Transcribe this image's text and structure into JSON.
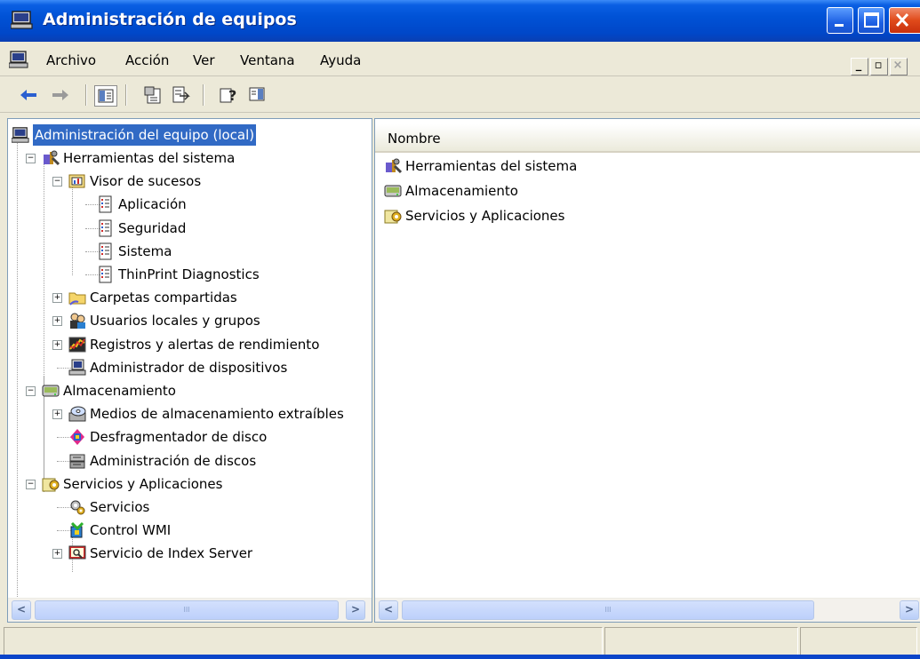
{
  "window": {
    "title": "Administración de equipos",
    "title_bar_color": "#0052d6",
    "buttons": [
      "minimize",
      "maximize",
      "close"
    ]
  },
  "menu": {
    "items": [
      "Archivo",
      "Acción",
      "Ver",
      "Ventana",
      "Ayuda"
    ],
    "mdi_controls": [
      "minimize",
      "restore",
      "close"
    ]
  },
  "toolbar": {
    "buttons": [
      "back-icon",
      "forward-icon",
      "show-hide-tree-icon",
      "properties-icon",
      "export-list-icon",
      "help-icon",
      "show-hide-action-pane-icon"
    ]
  },
  "tree": {
    "root": "Administración del equipo (local)",
    "items": [
      {
        "label": "Herramientas del sistema",
        "level": 1,
        "expander": "minus",
        "icon": "tools-icon"
      },
      {
        "label": "Visor de sucesos",
        "level": 2,
        "expander": "minus",
        "icon": "event-viewer-icon"
      },
      {
        "label": "Aplicación",
        "level": 3,
        "expander": "none",
        "icon": "log-icon"
      },
      {
        "label": "Seguridad",
        "level": 3,
        "expander": "none",
        "icon": "log-icon"
      },
      {
        "label": "Sistema",
        "level": 3,
        "expander": "none",
        "icon": "log-icon"
      },
      {
        "label": "ThinPrint Diagnostics",
        "level": 3,
        "expander": "none",
        "icon": "log-icon"
      },
      {
        "label": "Carpetas compartidas",
        "level": 2,
        "expander": "plus",
        "icon": "shared-folder-icon"
      },
      {
        "label": "Usuarios locales y grupos",
        "level": 2,
        "expander": "plus",
        "icon": "users-icon"
      },
      {
        "label": "Registros y alertas de rendimiento",
        "level": 2,
        "expander": "plus",
        "icon": "performance-icon"
      },
      {
        "label": "Administrador de dispositivos",
        "level": 2,
        "expander": "none",
        "icon": "device-manager-icon"
      },
      {
        "label": "Almacenamiento",
        "level": 1,
        "expander": "minus",
        "icon": "storage-icon"
      },
      {
        "label": "Medios de almacenamiento extraíbles",
        "level": 2,
        "expander": "plus",
        "icon": "removable-storage-icon"
      },
      {
        "label": "Desfragmentador de disco",
        "level": 2,
        "expander": "none",
        "icon": "defrag-icon"
      },
      {
        "label": "Administración de discos",
        "level": 2,
        "expander": "none",
        "icon": "disk-management-icon"
      },
      {
        "label": "Servicios y Aplicaciones",
        "level": 1,
        "expander": "minus",
        "icon": "services-apps-icon"
      },
      {
        "label": "Servicios",
        "level": 2,
        "expander": "none",
        "icon": "services-icon"
      },
      {
        "label": "Control WMI",
        "level": 2,
        "expander": "none",
        "icon": "wmi-icon"
      },
      {
        "label": "Servicio de Index Server",
        "level": 2,
        "expander": "plus",
        "icon": "index-server-icon"
      }
    ]
  },
  "list": {
    "column": "Nombre",
    "items": [
      {
        "label": "Herramientas del sistema",
        "icon": "tools-icon"
      },
      {
        "label": "Almacenamiento",
        "icon": "storage-icon"
      },
      {
        "label": "Servicios y Aplicaciones",
        "icon": "services-apps-icon"
      }
    ]
  },
  "scroll_thumb_label": "III"
}
